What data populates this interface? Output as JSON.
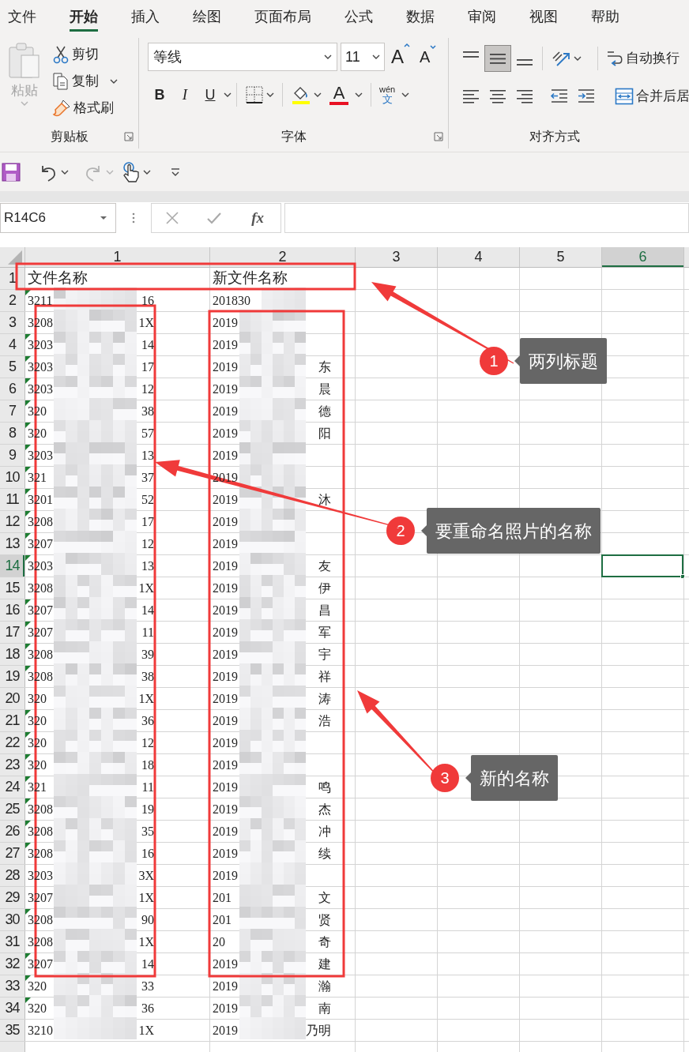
{
  "ribbon_tabs": [
    {
      "label": "文件",
      "selected": false
    },
    {
      "label": "开始",
      "selected": true
    },
    {
      "label": "插入",
      "selected": false
    },
    {
      "label": "绘图",
      "selected": false
    },
    {
      "label": "页面布局",
      "selected": false
    },
    {
      "label": "公式",
      "selected": false
    },
    {
      "label": "数据",
      "selected": false
    },
    {
      "label": "审阅",
      "selected": false
    },
    {
      "label": "视图",
      "selected": false
    },
    {
      "label": "帮助",
      "selected": false
    }
  ],
  "clipboard": {
    "paste": {
      "label": "粘贴",
      "disabled": true
    },
    "cut": "剪切",
    "copy": "复制",
    "format_painter": "格式刷",
    "group_label": "剪贴板"
  },
  "font": {
    "name": "等线",
    "size": "11",
    "grow": "A",
    "shrink": "A",
    "bold": "B",
    "italic": "I",
    "underline": "U",
    "font_color": "A",
    "phonetic_ruby": "wén",
    "phonetic_char": "文",
    "group_label": "字体"
  },
  "alignment": {
    "vertical": [
      {
        "kind": "top",
        "selected": false
      },
      {
        "kind": "middle",
        "selected": true
      },
      {
        "kind": "bottom",
        "selected": false
      }
    ],
    "wrap_text": "自动换行",
    "merge": "合并后居",
    "group_label": "对齐方式"
  },
  "quick_access": {
    "undo": {
      "disabled": false
    },
    "redo": {
      "disabled": true
    }
  },
  "formula_bar": {
    "name_box": "R14C6",
    "function_label": "fx"
  },
  "columns": [
    {
      "label": "1",
      "selected": false
    },
    {
      "label": "2",
      "selected": false
    },
    {
      "label": "3",
      "selected": false
    },
    {
      "label": "4",
      "selected": false
    },
    {
      "label": "5",
      "selected": false
    },
    {
      "label": "6",
      "selected": true
    }
  ],
  "header_row": {
    "row": "1",
    "selected": false,
    "cells": [
      "文件名称",
      "新文件名称"
    ]
  },
  "rows": [
    {
      "row": "2",
      "selected": false,
      "flag": true,
      "c1": [
        "3211",
        "16"
      ],
      "c2": [
        "201830"
      ]
    },
    {
      "row": "3",
      "selected": false,
      "flag": false,
      "c1": [
        "3208",
        "1X"
      ],
      "c2": [
        "2019"
      ]
    },
    {
      "row": "4",
      "selected": false,
      "flag": true,
      "c1": [
        "3203",
        "14"
      ],
      "c2": [
        "2019"
      ]
    },
    {
      "row": "5",
      "selected": false,
      "flag": true,
      "c1": [
        "3203",
        "17"
      ],
      "c2": [
        "2019",
        "东"
      ]
    },
    {
      "row": "6",
      "selected": false,
      "flag": true,
      "c1": [
        "3203",
        "12"
      ],
      "c2": [
        "2019",
        "晨"
      ]
    },
    {
      "row": "7",
      "selected": false,
      "flag": true,
      "c1": [
        "320",
        "38"
      ],
      "c2": [
        "2019",
        "德"
      ]
    },
    {
      "row": "8",
      "selected": false,
      "flag": true,
      "c1": [
        "320",
        "57"
      ],
      "c2": [
        "2019",
        "阳"
      ]
    },
    {
      "row": "9",
      "selected": false,
      "flag": true,
      "c1": [
        "3203",
        "13"
      ],
      "c2": [
        "2019"
      ]
    },
    {
      "row": "10",
      "selected": false,
      "flag": true,
      "c1": [
        "321",
        "37"
      ],
      "c2": [
        "2019"
      ]
    },
    {
      "row": "11",
      "selected": false,
      "flag": true,
      "c1": [
        "3201",
        "52"
      ],
      "c2": [
        "2019",
        "沐"
      ]
    },
    {
      "row": "12",
      "selected": false,
      "flag": true,
      "c1": [
        "3208",
        "17"
      ],
      "c2": [
        "2019"
      ]
    },
    {
      "row": "13",
      "selected": false,
      "flag": true,
      "c1": [
        "3207",
        "12"
      ],
      "c2": [
        "2019"
      ]
    },
    {
      "row": "14",
      "selected": true,
      "flag": true,
      "c1": [
        "3203",
        "13"
      ],
      "c2": [
        "2019",
        "友"
      ]
    },
    {
      "row": "15",
      "selected": false,
      "flag": false,
      "c1": [
        "3208",
        "1X"
      ],
      "c2": [
        "2019",
        "伊"
      ]
    },
    {
      "row": "16",
      "selected": false,
      "flag": true,
      "c1": [
        "3207",
        "14"
      ],
      "c2": [
        "2019",
        "昌"
      ]
    },
    {
      "row": "17",
      "selected": false,
      "flag": true,
      "c1": [
        "3207",
        "11"
      ],
      "c2": [
        "2019",
        "军"
      ]
    },
    {
      "row": "18",
      "selected": false,
      "flag": true,
      "c1": [
        "3208",
        "39"
      ],
      "c2": [
        "2019",
        "宇"
      ]
    },
    {
      "row": "19",
      "selected": false,
      "flag": true,
      "c1": [
        "3208",
        "38"
      ],
      "c2": [
        "2019",
        "祥"
      ]
    },
    {
      "row": "20",
      "selected": false,
      "flag": false,
      "c1": [
        "320",
        "1X"
      ],
      "c2": [
        "2019",
        "涛"
      ]
    },
    {
      "row": "21",
      "selected": false,
      "flag": true,
      "c1": [
        "320",
        "36"
      ],
      "c2": [
        "2019",
        "浩"
      ]
    },
    {
      "row": "22",
      "selected": false,
      "flag": true,
      "c1": [
        "320",
        "12"
      ],
      "c2": [
        "2019"
      ]
    },
    {
      "row": "23",
      "selected": false,
      "flag": true,
      "c1": [
        "320",
        "18"
      ],
      "c2": [
        "2019"
      ]
    },
    {
      "row": "24",
      "selected": false,
      "flag": true,
      "c1": [
        "321",
        "11"
      ],
      "c2": [
        "2019",
        "鸣"
      ]
    },
    {
      "row": "25",
      "selected": false,
      "flag": true,
      "c1": [
        "3208",
        "19"
      ],
      "c2": [
        "2019",
        "杰"
      ]
    },
    {
      "row": "26",
      "selected": false,
      "flag": true,
      "c1": [
        "3208",
        "35"
      ],
      "c2": [
        "2019",
        "冲"
      ]
    },
    {
      "row": "27",
      "selected": false,
      "flag": true,
      "c1": [
        "3208",
        "16"
      ],
      "c2": [
        "2019",
        "续"
      ]
    },
    {
      "row": "28",
      "selected": false,
      "flag": false,
      "c1": [
        "3203",
        "3X"
      ],
      "c2": [
        "2019"
      ]
    },
    {
      "row": "29",
      "selected": false,
      "flag": false,
      "c1": [
        "3207",
        "1X"
      ],
      "c2": [
        "201",
        "文"
      ]
    },
    {
      "row": "30",
      "selected": false,
      "flag": true,
      "c1": [
        "3208",
        "90"
      ],
      "c2": [
        "201",
        "贤"
      ]
    },
    {
      "row": "31",
      "selected": false,
      "flag": false,
      "c1": [
        "3208",
        "1X"
      ],
      "c2": [
        "20",
        "奇"
      ]
    },
    {
      "row": "32",
      "selected": false,
      "flag": true,
      "c1": [
        "3207",
        "14"
      ],
      "c2": [
        "2019",
        "建"
      ]
    },
    {
      "row": "33",
      "selected": false,
      "flag": true,
      "c1": [
        "320",
        "33"
      ],
      "c2": [
        "2019",
        "瀚"
      ]
    },
    {
      "row": "34",
      "selected": false,
      "flag": true,
      "c1": [
        "320",
        "36"
      ],
      "c2": [
        "2019",
        "南"
      ]
    },
    {
      "row": "35",
      "selected": false,
      "flag": false,
      "c1": [
        "3210",
        "1X"
      ],
      "c2": [
        "2019",
        "乃明"
      ]
    }
  ],
  "annotations": [
    {
      "number": "1",
      "label": "两列标题"
    },
    {
      "number": "2",
      "label": "要重命名照片的名称"
    },
    {
      "number": "3",
      "label": "新的名称"
    }
  ]
}
